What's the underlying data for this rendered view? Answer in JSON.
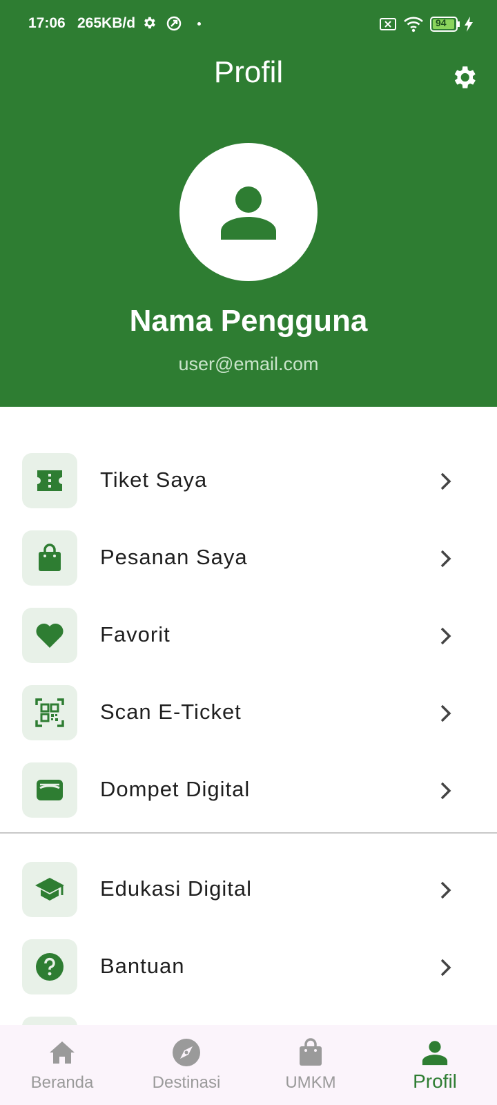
{
  "status_bar": {
    "time": "17:06",
    "speed": "265KB/d",
    "battery": "94"
  },
  "header": {
    "title": "Profil",
    "background": "#2e7d32"
  },
  "profile": {
    "name": "Nama Pengguna",
    "email": "user@email.com"
  },
  "menu": {
    "items": [
      {
        "label": "Tiket Saya",
        "icon": "ticket-icon"
      },
      {
        "label": "Pesanan Saya",
        "icon": "shopping-bag-icon"
      },
      {
        "label": "Favorit",
        "icon": "heart-icon"
      },
      {
        "label": "Scan E-Ticket",
        "icon": "qr-scan-icon"
      },
      {
        "label": "Dompet Digital",
        "icon": "wallet-icon"
      },
      {
        "label": "Edukasi Digital",
        "icon": "graduation-cap-icon"
      },
      {
        "label": "Bantuan",
        "icon": "help-icon"
      }
    ]
  },
  "bottom_nav": {
    "items": [
      {
        "label": "Beranda",
        "icon": "home-icon",
        "active": false
      },
      {
        "label": "Destinasi",
        "icon": "compass-icon",
        "active": false
      },
      {
        "label": "UMKM",
        "icon": "shopping-bag-icon",
        "active": false
      },
      {
        "label": "Profil",
        "icon": "person-icon",
        "active": true
      }
    ]
  },
  "colors": {
    "primary": "#2e7d32",
    "icon_tile": "#e8f1e8",
    "nav_background": "#fbf4fb",
    "nav_inactive": "#9a9a9a"
  }
}
